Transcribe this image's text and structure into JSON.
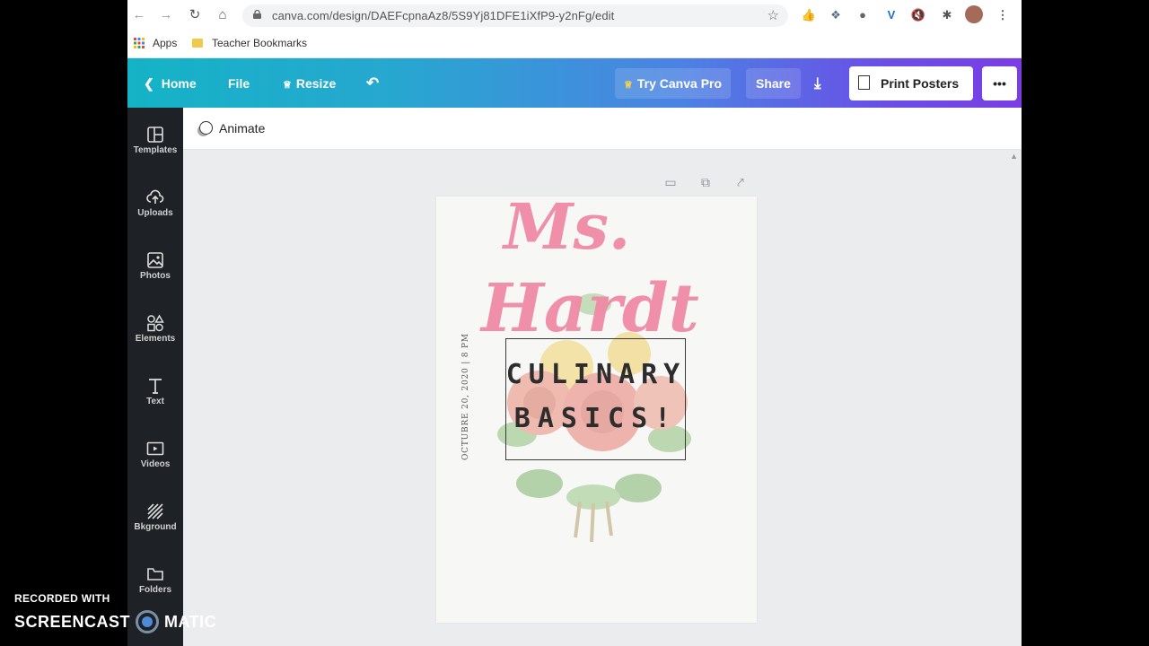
{
  "browser": {
    "url": "canva.com/design/DAEFcpnaAz8/5S9Yj81DFE1iXfP9-y2nFg/edit",
    "bookmarks": [
      "Apps",
      "Teacher Bookmarks"
    ]
  },
  "canva_header": {
    "home": "Home",
    "file": "File",
    "resize": "Resize",
    "try_pro": "Try Canva Pro",
    "share": "Share",
    "print": "Print Posters",
    "more": "•••"
  },
  "sidebar": {
    "items": [
      {
        "label": "Templates",
        "icon": "templates-icon"
      },
      {
        "label": "Uploads",
        "icon": "upload-icon"
      },
      {
        "label": "Photos",
        "icon": "photo-icon"
      },
      {
        "label": "Elements",
        "icon": "elements-icon"
      },
      {
        "label": "Text",
        "icon": "text-icon"
      },
      {
        "label": "Videos",
        "icon": "video-icon"
      },
      {
        "label": "Bkground",
        "icon": "background-icon"
      },
      {
        "label": "Folders",
        "icon": "folder-icon"
      }
    ]
  },
  "toolbar": {
    "animate": "Animate"
  },
  "design": {
    "script_line1": "Ms.",
    "script_line2": "Hardt",
    "title_line1": "CULINARY",
    "title_line2": "BASICS!",
    "date": "OCTUBRE 20, 2020 | 8 PM"
  },
  "watermark": {
    "line1": "RECORDED WITH",
    "line2a": "SCREENCAST",
    "line2b": "MATIC"
  },
  "colors": {
    "accent_gradient_start": "#14b3c6",
    "accent_gradient_end": "#7a3ee4",
    "sidebar_bg": "#1e2125",
    "script_pink": "#f08aa6"
  }
}
